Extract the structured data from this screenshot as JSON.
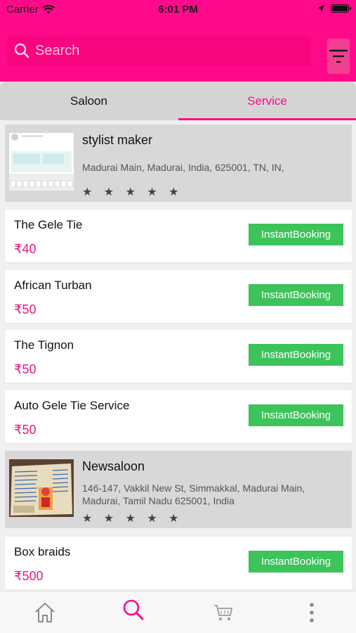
{
  "status": {
    "carrier": "Carrier",
    "time": "6:01 PM"
  },
  "search": {
    "placeholder": "Search"
  },
  "tabs": [
    {
      "label": "Saloon",
      "active": false
    },
    {
      "label": "Service",
      "active": true
    }
  ],
  "saloons": [
    {
      "name": "stylist maker",
      "address": "Madurai Main, Madurai, India, 625001, TN, IN,",
      "stars": "★ ★ ★ ★ ★"
    },
    {
      "name": "Newsaloon",
      "address": "146-147, Vakkil New St, Simmakkal, Madurai Main, Madurai, Tamil Nadu 625001, India",
      "stars": "★ ★ ★ ★ ★"
    }
  ],
  "services": [
    {
      "name": "The Gele Tie",
      "price": "₹40",
      "button": "InstantBooking"
    },
    {
      "name": "African Turban",
      "price": "₹50",
      "button": "InstantBooking"
    },
    {
      "name": "The Tignon",
      "price": "₹50",
      "button": "InstantBooking"
    },
    {
      "name": "Auto Gele Tie Service",
      "price": "₹50",
      "button": "InstantBooking"
    },
    {
      "name": "Box braids",
      "price": "₹500",
      "button": "InstantBooking"
    }
  ],
  "nav": [
    {
      "icon": "home-icon",
      "active": false
    },
    {
      "icon": "search-icon",
      "active": true
    },
    {
      "icon": "cart-icon",
      "active": false
    },
    {
      "icon": "more-icon",
      "active": false
    }
  ],
  "colors": {
    "primary": "#ff0a8a",
    "booking": "#3cc35a",
    "price": "#e8197f"
  }
}
